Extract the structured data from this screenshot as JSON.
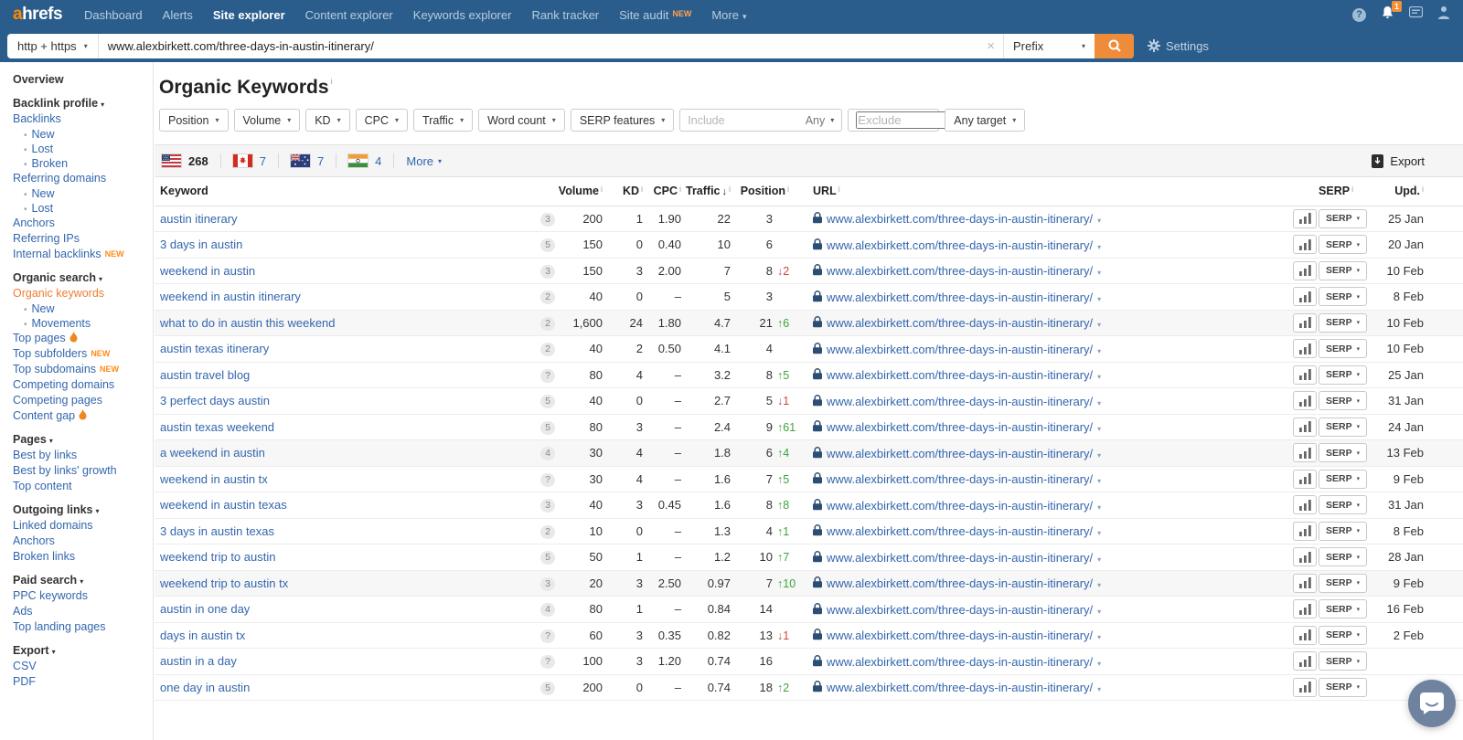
{
  "glyphs": {
    "caret": "▾",
    "clear_icon": "×",
    "bullet": "•",
    "up_arrow": "↑",
    "down_arrow": "↓"
  },
  "header": {
    "logo_a": "a",
    "logo_rest": "hrefs",
    "nav": [
      {
        "label": "Dashboard"
      },
      {
        "label": "Alerts"
      },
      {
        "label": "Site explorer",
        "active": true
      },
      {
        "label": "Content explorer"
      },
      {
        "label": "Keywords explorer"
      },
      {
        "label": "Rank tracker"
      },
      {
        "label": "Site audit",
        "badge": "NEW"
      },
      {
        "label": "More",
        "caret": true
      }
    ],
    "notification_count": "1"
  },
  "searchbar": {
    "protocol": "http + https",
    "url_value": "www.alexbirkett.com/three-days-in-austin-itinerary/",
    "mode": "Prefix",
    "settings_label": "Settings"
  },
  "sidebar": {
    "items": [
      {
        "label": "Overview",
        "t": "h"
      },
      {
        "label": "Backlink profile",
        "t": "h",
        "caret": true
      },
      {
        "label": "Backlinks",
        "t": "l"
      },
      {
        "label": "New",
        "t": "s"
      },
      {
        "label": "Lost",
        "t": "s"
      },
      {
        "label": "Broken",
        "t": "s"
      },
      {
        "label": "Referring domains",
        "t": "l"
      },
      {
        "label": "New",
        "t": "s"
      },
      {
        "label": "Lost",
        "t": "s"
      },
      {
        "label": "Anchors",
        "t": "l"
      },
      {
        "label": "Referring IPs",
        "t": "l"
      },
      {
        "label": "Internal backlinks",
        "t": "l",
        "badge": "NEW"
      },
      {
        "label": "Organic search",
        "t": "h",
        "caret": true
      },
      {
        "label": "Organic keywords",
        "t": "l",
        "active": true
      },
      {
        "label": "New",
        "t": "s"
      },
      {
        "label": "Movements",
        "t": "s"
      },
      {
        "label": "Top pages",
        "t": "l",
        "fire": true
      },
      {
        "label": "Top subfolders",
        "t": "l",
        "badge": "NEW"
      },
      {
        "label": "Top subdomains",
        "t": "l",
        "badge": "NEW"
      },
      {
        "label": "Competing domains",
        "t": "l"
      },
      {
        "label": "Competing pages",
        "t": "l"
      },
      {
        "label": "Content gap",
        "t": "l",
        "fire": true
      },
      {
        "label": "Pages",
        "t": "h",
        "caret": true
      },
      {
        "label": "Best by links",
        "t": "l"
      },
      {
        "label": "Best by links' growth",
        "t": "l"
      },
      {
        "label": "Top content",
        "t": "l"
      },
      {
        "label": "Outgoing links",
        "t": "h",
        "caret": true
      },
      {
        "label": "Linked domains",
        "t": "l"
      },
      {
        "label": "Anchors",
        "t": "l"
      },
      {
        "label": "Broken links",
        "t": "l"
      },
      {
        "label": "Paid search",
        "t": "h",
        "caret": true
      },
      {
        "label": "PPC keywords",
        "t": "l"
      },
      {
        "label": "Ads",
        "t": "l"
      },
      {
        "label": "Top landing pages",
        "t": "l"
      },
      {
        "label": "Export",
        "t": "h",
        "caret": true
      },
      {
        "label": "CSV",
        "t": "l"
      },
      {
        "label": "PDF",
        "t": "l"
      }
    ]
  },
  "main": {
    "title": "Organic Keywords",
    "info_mark": "i",
    "filters": [
      "Position",
      "Volume",
      "KD",
      "CPC",
      "Traffic",
      "Word count",
      "SERP features"
    ],
    "include_placeholder": "Include",
    "include_any": "Any",
    "exclude_placeholder": "Exclude",
    "any_target_label": "Any target",
    "countries": [
      {
        "code": "us",
        "count": "268",
        "bold": true
      },
      {
        "code": "ca",
        "count": "7"
      },
      {
        "code": "au",
        "count": "7"
      },
      {
        "code": "in",
        "count": "4"
      }
    ],
    "more_label": "More",
    "export_label": "Export"
  },
  "table": {
    "columns": {
      "keyword": "Keyword",
      "volume": "Volume",
      "kd": "KD",
      "cpc": "CPC",
      "traffic": "Traffic",
      "position": "Position",
      "url": "URL",
      "serp": "SERP",
      "upd": "Upd."
    },
    "sort_indicator": "↓",
    "serp_button_label": "SERP",
    "rows": [
      {
        "keyword": "austin itinerary",
        "badge": "3",
        "volume": "200",
        "kd": "1",
        "cpc": "1.90",
        "traffic": "22",
        "position": "3",
        "change": "",
        "dir": "",
        "url": "www.alexbirkett.com/three-days-in-austin-itinerary/",
        "date": "25 Jan",
        "shaded": false
      },
      {
        "keyword": "3 days in austin",
        "badge": "5",
        "volume": "150",
        "kd": "0",
        "cpc": "0.40",
        "traffic": "10",
        "position": "6",
        "change": "",
        "dir": "",
        "url": "www.alexbirkett.com/three-days-in-austin-itinerary/",
        "date": "20 Jan",
        "shaded": false
      },
      {
        "keyword": "weekend in austin",
        "badge": "3",
        "volume": "150",
        "kd": "3",
        "cpc": "2.00",
        "traffic": "7",
        "position": "8",
        "change": "2",
        "dir": "down",
        "url": "www.alexbirkett.com/three-days-in-austin-itinerary/",
        "date": "10 Feb",
        "shaded": false
      },
      {
        "keyword": "weekend in austin itinerary",
        "badge": "2",
        "volume": "40",
        "kd": "0",
        "cpc": "–",
        "traffic": "5",
        "position": "3",
        "change": "",
        "dir": "",
        "url": "www.alexbirkett.com/three-days-in-austin-itinerary/",
        "date": "8 Feb",
        "shaded": false
      },
      {
        "keyword": "what to do in austin this weekend",
        "badge": "2",
        "volume": "1,600",
        "kd": "24",
        "cpc": "1.80",
        "traffic": "4.7",
        "position": "21",
        "change": "6",
        "dir": "up",
        "url": "www.alexbirkett.com/three-days-in-austin-itinerary/",
        "date": "10 Feb",
        "shaded": true
      },
      {
        "keyword": "austin texas itinerary",
        "badge": "2",
        "volume": "40",
        "kd": "2",
        "cpc": "0.50",
        "traffic": "4.1",
        "position": "4",
        "change": "",
        "dir": "",
        "url": "www.alexbirkett.com/three-days-in-austin-itinerary/",
        "date": "10 Feb",
        "shaded": false
      },
      {
        "keyword": "austin travel blog",
        "badge": "?",
        "volume": "80",
        "kd": "4",
        "cpc": "–",
        "traffic": "3.2",
        "position": "8",
        "change": "5",
        "dir": "up",
        "url": "www.alexbirkett.com/three-days-in-austin-itinerary/",
        "date": "25 Jan",
        "shaded": false
      },
      {
        "keyword": "3 perfect days austin",
        "badge": "5",
        "volume": "40",
        "kd": "0",
        "cpc": "–",
        "traffic": "2.7",
        "position": "5",
        "change": "1",
        "dir": "down",
        "url": "www.alexbirkett.com/three-days-in-austin-itinerary/",
        "date": "31 Jan",
        "shaded": false
      },
      {
        "keyword": "austin texas weekend",
        "badge": "5",
        "volume": "80",
        "kd": "3",
        "cpc": "–",
        "traffic": "2.4",
        "position": "9",
        "change": "61",
        "dir": "up",
        "url": "www.alexbirkett.com/three-days-in-austin-itinerary/",
        "date": "24 Jan",
        "shaded": false
      },
      {
        "keyword": "a weekend in austin",
        "badge": "4",
        "volume": "30",
        "kd": "4",
        "cpc": "–",
        "traffic": "1.8",
        "position": "6",
        "change": "4",
        "dir": "up",
        "url": "www.alexbirkett.com/three-days-in-austin-itinerary/",
        "date": "13 Feb",
        "shaded": true
      },
      {
        "keyword": "weekend in austin tx",
        "badge": "?",
        "volume": "30",
        "kd": "4",
        "cpc": "–",
        "traffic": "1.6",
        "position": "7",
        "change": "5",
        "dir": "up",
        "url": "www.alexbirkett.com/three-days-in-austin-itinerary/",
        "date": "9 Feb",
        "shaded": false
      },
      {
        "keyword": "weekend in austin texas",
        "badge": "3",
        "volume": "40",
        "kd": "3",
        "cpc": "0.45",
        "traffic": "1.6",
        "position": "8",
        "change": "8",
        "dir": "up",
        "url": "www.alexbirkett.com/three-days-in-austin-itinerary/",
        "date": "31 Jan",
        "shaded": false
      },
      {
        "keyword": "3 days in austin texas",
        "badge": "2",
        "volume": "10",
        "kd": "0",
        "cpc": "–",
        "traffic": "1.3",
        "position": "4",
        "change": "1",
        "dir": "up",
        "url": "www.alexbirkett.com/three-days-in-austin-itinerary/",
        "date": "8 Feb",
        "shaded": false
      },
      {
        "keyword": "weekend trip to austin",
        "badge": "5",
        "volume": "50",
        "kd": "1",
        "cpc": "–",
        "traffic": "1.2",
        "position": "10",
        "change": "7",
        "dir": "up",
        "url": "www.alexbirkett.com/three-days-in-austin-itinerary/",
        "date": "28 Jan",
        "shaded": false
      },
      {
        "keyword": "weekend trip to austin tx",
        "badge": "3",
        "volume": "20",
        "kd": "3",
        "cpc": "2.50",
        "traffic": "0.97",
        "position": "7",
        "change": "10",
        "dir": "up",
        "url": "www.alexbirkett.com/three-days-in-austin-itinerary/",
        "date": "9 Feb",
        "shaded": true
      },
      {
        "keyword": "austin in one day",
        "badge": "4",
        "volume": "80",
        "kd": "1",
        "cpc": "–",
        "traffic": "0.84",
        "position": "14",
        "change": "",
        "dir": "",
        "url": "www.alexbirkett.com/three-days-in-austin-itinerary/",
        "date": "16 Feb",
        "shaded": false
      },
      {
        "keyword": "days in austin tx",
        "badge": "?",
        "volume": "60",
        "kd": "3",
        "cpc": "0.35",
        "traffic": "0.82",
        "position": "13",
        "change": "1",
        "dir": "down",
        "url": "www.alexbirkett.com/three-days-in-austin-itinerary/",
        "date": "2 Feb",
        "shaded": false
      },
      {
        "keyword": "austin in a day",
        "badge": "?",
        "volume": "100",
        "kd": "3",
        "cpc": "1.20",
        "traffic": "0.74",
        "position": "16",
        "change": "",
        "dir": "",
        "url": "www.alexbirkett.com/three-days-in-austin-itinerary/",
        "date": "",
        "shaded": false
      },
      {
        "keyword": "one day in austin",
        "badge": "5",
        "volume": "200",
        "kd": "0",
        "cpc": "–",
        "traffic": "0.74",
        "position": "18",
        "change": "2",
        "dir": "up",
        "url": "www.alexbirkett.com/three-days-in-austin-itinerary/",
        "date": "",
        "shaded": false
      }
    ]
  }
}
